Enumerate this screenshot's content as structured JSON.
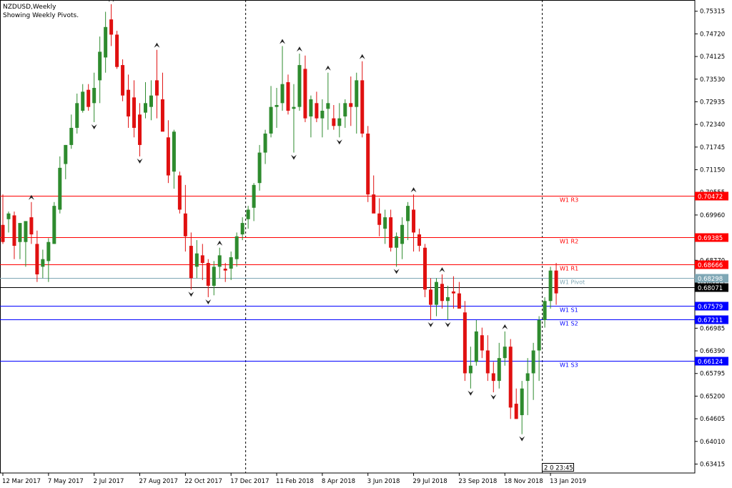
{
  "chart_data": {
    "type": "candlestick",
    "title": "NZDUSD,Weekly",
    "subtitle": "Showing Weekly Pivots.",
    "ylim": [
      0.6318,
      0.7561
    ],
    "y_ticks": [
      "0.75315",
      "0.74720",
      "0.74125",
      "0.73530",
      "0.72935",
      "0.72340",
      "0.71745",
      "0.71150",
      "0.70555",
      "0.69960",
      "0.69365",
      "0.68770",
      "0.68175",
      "0.67580",
      "0.66985",
      "0.66390",
      "0.65795",
      "0.65200",
      "0.64605",
      "0.64010",
      "0.63415"
    ],
    "x_labels": [
      {
        "label": "12 Mar 2017",
        "i": 0
      },
      {
        "label": "7 May 2017",
        "i": 8
      },
      {
        "label": "2 Jul 2017",
        "i": 16
      },
      {
        "label": "27 Aug 2017",
        "i": 24
      },
      {
        "label": "22 Oct 2017",
        "i": 32
      },
      {
        "label": "17 Dec 2017",
        "i": 40
      },
      {
        "label": "11 Feb 2018",
        "i": 48
      },
      {
        "label": "8 Apr 2018",
        "i": 56
      },
      {
        "label": "3 Jun 2018",
        "i": 64
      },
      {
        "label": "29 Jul 2018",
        "i": 72
      },
      {
        "label": "23 Sep 2018",
        "i": 80
      },
      {
        "label": "18 Nov 2018",
        "i": 88
      },
      {
        "label": "13 Jan 2019",
        "i": 96
      }
    ],
    "period_separators": [
      43,
      95
    ],
    "candles": [
      {
        "o": 0.697,
        "h": 0.705,
        "l": 0.692,
        "c": 0.6925
      },
      {
        "o": 0.6985,
        "h": 0.7005,
        "l": 0.695,
        "c": 0.7
      },
      {
        "o": 0.6995,
        "h": 0.7005,
        "l": 0.688,
        "c": 0.6915
      },
      {
        "o": 0.6925,
        "h": 0.696,
        "l": 0.688,
        "c": 0.6975
      },
      {
        "o": 0.6925,
        "h": 0.695,
        "l": 0.686,
        "c": 0.698
      },
      {
        "o": 0.699,
        "h": 0.703,
        "l": 0.692,
        "c": 0.6945
      },
      {
        "o": 0.692,
        "h": 0.6955,
        "l": 0.682,
        "c": 0.684
      },
      {
        "o": 0.686,
        "h": 0.6905,
        "l": 0.683,
        "c": 0.688
      },
      {
        "o": 0.6875,
        "h": 0.6935,
        "l": 0.682,
        "c": 0.6925
      },
      {
        "o": 0.692,
        "h": 0.703,
        "l": 0.692,
        "c": 0.702
      },
      {
        "o": 0.701,
        "h": 0.715,
        "l": 0.7,
        "c": 0.712
      },
      {
        "o": 0.713,
        "h": 0.718,
        "l": 0.709,
        "c": 0.718
      },
      {
        "o": 0.718,
        "h": 0.726,
        "l": 0.717,
        "c": 0.7225
      },
      {
        "o": 0.7225,
        "h": 0.7315,
        "l": 0.721,
        "c": 0.729
      },
      {
        "o": 0.727,
        "h": 0.734,
        "l": 0.7265,
        "c": 0.732
      },
      {
        "o": 0.7325,
        "h": 0.734,
        "l": 0.727,
        "c": 0.728
      },
      {
        "o": 0.729,
        "h": 0.737,
        "l": 0.724,
        "c": 0.733
      },
      {
        "o": 0.735,
        "h": 0.7465,
        "l": 0.729,
        "c": 0.7425
      },
      {
        "o": 0.741,
        "h": 0.753,
        "l": 0.737,
        "c": 0.749
      },
      {
        "o": 0.751,
        "h": 0.755,
        "l": 0.744,
        "c": 0.747
      },
      {
        "o": 0.747,
        "h": 0.748,
        "l": 0.738,
        "c": 0.7385
      },
      {
        "o": 0.739,
        "h": 0.7405,
        "l": 0.7295,
        "c": 0.731
      },
      {
        "o": 0.7325,
        "h": 0.7365,
        "l": 0.7225,
        "c": 0.7255
      },
      {
        "o": 0.7305,
        "h": 0.735,
        "l": 0.72,
        "c": 0.7225
      },
      {
        "o": 0.726,
        "h": 0.729,
        "l": 0.715,
        "c": 0.718
      },
      {
        "o": 0.7265,
        "h": 0.7345,
        "l": 0.725,
        "c": 0.729
      },
      {
        "o": 0.728,
        "h": 0.735,
        "l": 0.7245,
        "c": 0.731
      },
      {
        "o": 0.735,
        "h": 0.743,
        "l": 0.725,
        "c": 0.731
      },
      {
        "o": 0.73,
        "h": 0.737,
        "l": 0.728,
        "c": 0.7215
      },
      {
        "o": 0.72,
        "h": 0.7245,
        "l": 0.708,
        "c": 0.71
      },
      {
        "o": 0.711,
        "h": 0.722,
        "l": 0.7065,
        "c": 0.7215
      },
      {
        "o": 0.71,
        "h": 0.711,
        "l": 0.7,
        "c": 0.701
      },
      {
        "o": 0.7,
        "h": 0.7075,
        "l": 0.69,
        "c": 0.694
      },
      {
        "o": 0.6915,
        "h": 0.695,
        "l": 0.68,
        "c": 0.683
      },
      {
        "o": 0.686,
        "h": 0.693,
        "l": 0.683,
        "c": 0.6895
      },
      {
        "o": 0.689,
        "h": 0.692,
        "l": 0.6825,
        "c": 0.687
      },
      {
        "o": 0.687,
        "h": 0.688,
        "l": 0.678,
        "c": 0.681
      },
      {
        "o": 0.681,
        "h": 0.6875,
        "l": 0.6785,
        "c": 0.686
      },
      {
        "o": 0.686,
        "h": 0.691,
        "l": 0.683,
        "c": 0.689
      },
      {
        "o": 0.6855,
        "h": 0.687,
        "l": 0.682,
        "c": 0.685
      },
      {
        "o": 0.6855,
        "h": 0.69,
        "l": 0.6825,
        "c": 0.6885
      },
      {
        "o": 0.688,
        "h": 0.695,
        "l": 0.686,
        "c": 0.694
      },
      {
        "o": 0.6945,
        "h": 0.699,
        "l": 0.693,
        "c": 0.6975
      },
      {
        "o": 0.6985,
        "h": 0.702,
        "l": 0.696,
        "c": 0.701
      },
      {
        "o": 0.7015,
        "h": 0.708,
        "l": 0.698,
        "c": 0.7075
      },
      {
        "o": 0.708,
        "h": 0.718,
        "l": 0.706,
        "c": 0.716
      },
      {
        "o": 0.716,
        "h": 0.722,
        "l": 0.713,
        "c": 0.721
      },
      {
        "o": 0.721,
        "h": 0.7335,
        "l": 0.72,
        "c": 0.728
      },
      {
        "o": 0.728,
        "h": 0.733,
        "l": 0.7225,
        "c": 0.7285
      },
      {
        "o": 0.729,
        "h": 0.744,
        "l": 0.727,
        "c": 0.734
      },
      {
        "o": 0.7345,
        "h": 0.7365,
        "l": 0.726,
        "c": 0.727
      },
      {
        "o": 0.7275,
        "h": 0.734,
        "l": 0.716,
        "c": 0.728
      },
      {
        "o": 0.728,
        "h": 0.742,
        "l": 0.727,
        "c": 0.739
      },
      {
        "o": 0.738,
        "h": 0.7415,
        "l": 0.724,
        "c": 0.725
      },
      {
        "o": 0.7255,
        "h": 0.731,
        "l": 0.72,
        "c": 0.73
      },
      {
        "o": 0.729,
        "h": 0.732,
        "l": 0.724,
        "c": 0.725
      },
      {
        "o": 0.725,
        "h": 0.73,
        "l": 0.72,
        "c": 0.727
      },
      {
        "o": 0.7275,
        "h": 0.737,
        "l": 0.722,
        "c": 0.729
      },
      {
        "o": 0.725,
        "h": 0.7285,
        "l": 0.722,
        "c": 0.723
      },
      {
        "o": 0.723,
        "h": 0.729,
        "l": 0.72,
        "c": 0.725
      },
      {
        "o": 0.7255,
        "h": 0.73,
        "l": 0.7225,
        "c": 0.729
      },
      {
        "o": 0.729,
        "h": 0.736,
        "l": 0.723,
        "c": 0.728
      },
      {
        "o": 0.728,
        "h": 0.737,
        "l": 0.721,
        "c": 0.735
      },
      {
        "o": 0.735,
        "h": 0.74,
        "l": 0.72,
        "c": 0.721
      },
      {
        "o": 0.721,
        "h": 0.723,
        "l": 0.703,
        "c": 0.705
      },
      {
        "o": 0.705,
        "h": 0.71,
        "l": 0.702,
        "c": 0.7
      },
      {
        "o": 0.7,
        "h": 0.704,
        "l": 0.694,
        "c": 0.697
      },
      {
        "o": 0.696,
        "h": 0.701,
        "l": 0.692,
        "c": 0.699
      },
      {
        "o": 0.699,
        "h": 0.701,
        "l": 0.69,
        "c": 0.691
      },
      {
        "o": 0.691,
        "h": 0.695,
        "l": 0.686,
        "c": 0.694
      },
      {
        "o": 0.692,
        "h": 0.699,
        "l": 0.688,
        "c": 0.697
      },
      {
        "o": 0.698,
        "h": 0.703,
        "l": 0.693,
        "c": 0.702
      },
      {
        "o": 0.701,
        "h": 0.705,
        "l": 0.69,
        "c": 0.695
      },
      {
        "o": 0.6945,
        "h": 0.696,
        "l": 0.69,
        "c": 0.6915
      },
      {
        "o": 0.691,
        "h": 0.692,
        "l": 0.678,
        "c": 0.68
      },
      {
        "o": 0.68,
        "h": 0.683,
        "l": 0.672,
        "c": 0.676
      },
      {
        "o": 0.676,
        "h": 0.683,
        "l": 0.673,
        "c": 0.682
      },
      {
        "o": 0.6815,
        "h": 0.684,
        "l": 0.675,
        "c": 0.677
      },
      {
        "o": 0.677,
        "h": 0.681,
        "l": 0.672,
        "c": 0.678
      },
      {
        "o": 0.6795,
        "h": 0.6835,
        "l": 0.675,
        "c": 0.679
      },
      {
        "o": 0.679,
        "h": 0.682,
        "l": 0.675,
        "c": 0.675
      },
      {
        "o": 0.674,
        "h": 0.677,
        "l": 0.656,
        "c": 0.658
      },
      {
        "o": 0.658,
        "h": 0.665,
        "l": 0.654,
        "c": 0.66
      },
      {
        "o": 0.661,
        "h": 0.672,
        "l": 0.66,
        "c": 0.669
      },
      {
        "o": 0.668,
        "h": 0.67,
        "l": 0.662,
        "c": 0.664
      },
      {
        "o": 0.664,
        "h": 0.668,
        "l": 0.656,
        "c": 0.658
      },
      {
        "o": 0.658,
        "h": 0.661,
        "l": 0.653,
        "c": 0.656
      },
      {
        "o": 0.656,
        "h": 0.666,
        "l": 0.654,
        "c": 0.662
      },
      {
        "o": 0.662,
        "h": 0.669,
        "l": 0.66,
        "c": 0.665
      },
      {
        "o": 0.665,
        "h": 0.667,
        "l": 0.646,
        "c": 0.649
      },
      {
        "o": 0.65,
        "h": 0.654,
        "l": 0.646,
        "c": 0.646
      },
      {
        "o": 0.647,
        "h": 0.656,
        "l": 0.642,
        "c": 0.654
      },
      {
        "o": 0.656,
        "h": 0.662,
        "l": 0.647,
        "c": 0.658
      },
      {
        "o": 0.658,
        "h": 0.666,
        "l": 0.651,
        "c": 0.664
      },
      {
        "o": 0.664,
        "h": 0.673,
        "l": 0.656,
        "c": 0.672
      },
      {
        "o": 0.672,
        "h": 0.678,
        "l": 0.67,
        "c": 0.677
      },
      {
        "o": 0.677,
        "h": 0.686,
        "l": 0.675,
        "c": 0.685
      },
      {
        "o": 0.685,
        "h": 0.687,
        "l": 0.676,
        "c": 0.679
      }
    ],
    "pivot_levels": [
      {
        "name": "W1  R3",
        "value": 0.70472,
        "tag": "0.70472",
        "color": "#ff0000"
      },
      {
        "name": "W1  R2",
        "value": 0.69385,
        "tag": "0.69385",
        "color": "#ff0000"
      },
      {
        "name": "W1  R1",
        "value": 0.68666,
        "tag": "0.68666",
        "color": "#ff0000"
      },
      {
        "name": "W1  Pivot",
        "value": 0.68298,
        "tag": "0.68298",
        "color": "#7fa7b5"
      },
      {
        "name": "",
        "value": 0.68071,
        "tag": "0.68071",
        "color": "#000000"
      },
      {
        "name": "W1  S1",
        "value": 0.67579,
        "tag": "0.67579",
        "color": "#0000ff"
      },
      {
        "name": "W1  S2",
        "value": 0.67211,
        "tag": "0.67211",
        "color": "#0000ff"
      },
      {
        "name": "W1  S3",
        "value": 0.66124,
        "tag": "0.66124",
        "color": "#0000ff"
      }
    ],
    "countdown": "2 0 23:45",
    "colors": {
      "bull": "#2e8b2e",
      "bear": "#e01010",
      "grid": "#000000",
      "fractal": "#000000"
    }
  }
}
